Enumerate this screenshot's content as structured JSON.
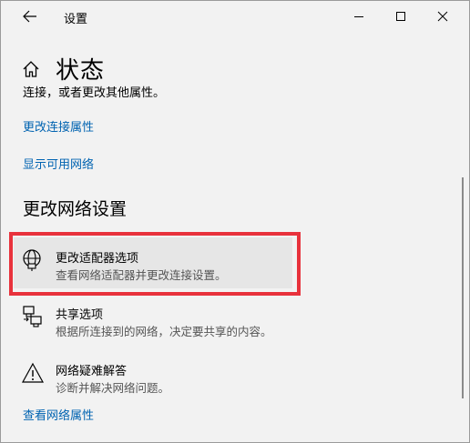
{
  "window": {
    "title": "设置"
  },
  "header": {
    "page_title": "状态"
  },
  "content": {
    "partial_text": "连接，或者更改其他属性。",
    "link_change_connection_props": "更改连接属性",
    "link_show_networks": "显示可用网络",
    "section_title": "更改网络设置",
    "items": [
      {
        "title": "更改适配器选项",
        "desc": "查看网络适配器并更改连接设置。",
        "icon": "adapter-icon"
      },
      {
        "title": "共享选项",
        "desc": "根据所连接到的网络，决定要共享的内容。",
        "icon": "sharing-icon"
      },
      {
        "title": "网络疑难解答",
        "desc": "诊断并解决网络问题。",
        "icon": "warning-icon"
      }
    ],
    "link_view_network_props": "查看网络属性"
  },
  "colors": {
    "link": "#0063b1",
    "highlight_border": "#e8323c",
    "background": "#f2f2f2"
  }
}
